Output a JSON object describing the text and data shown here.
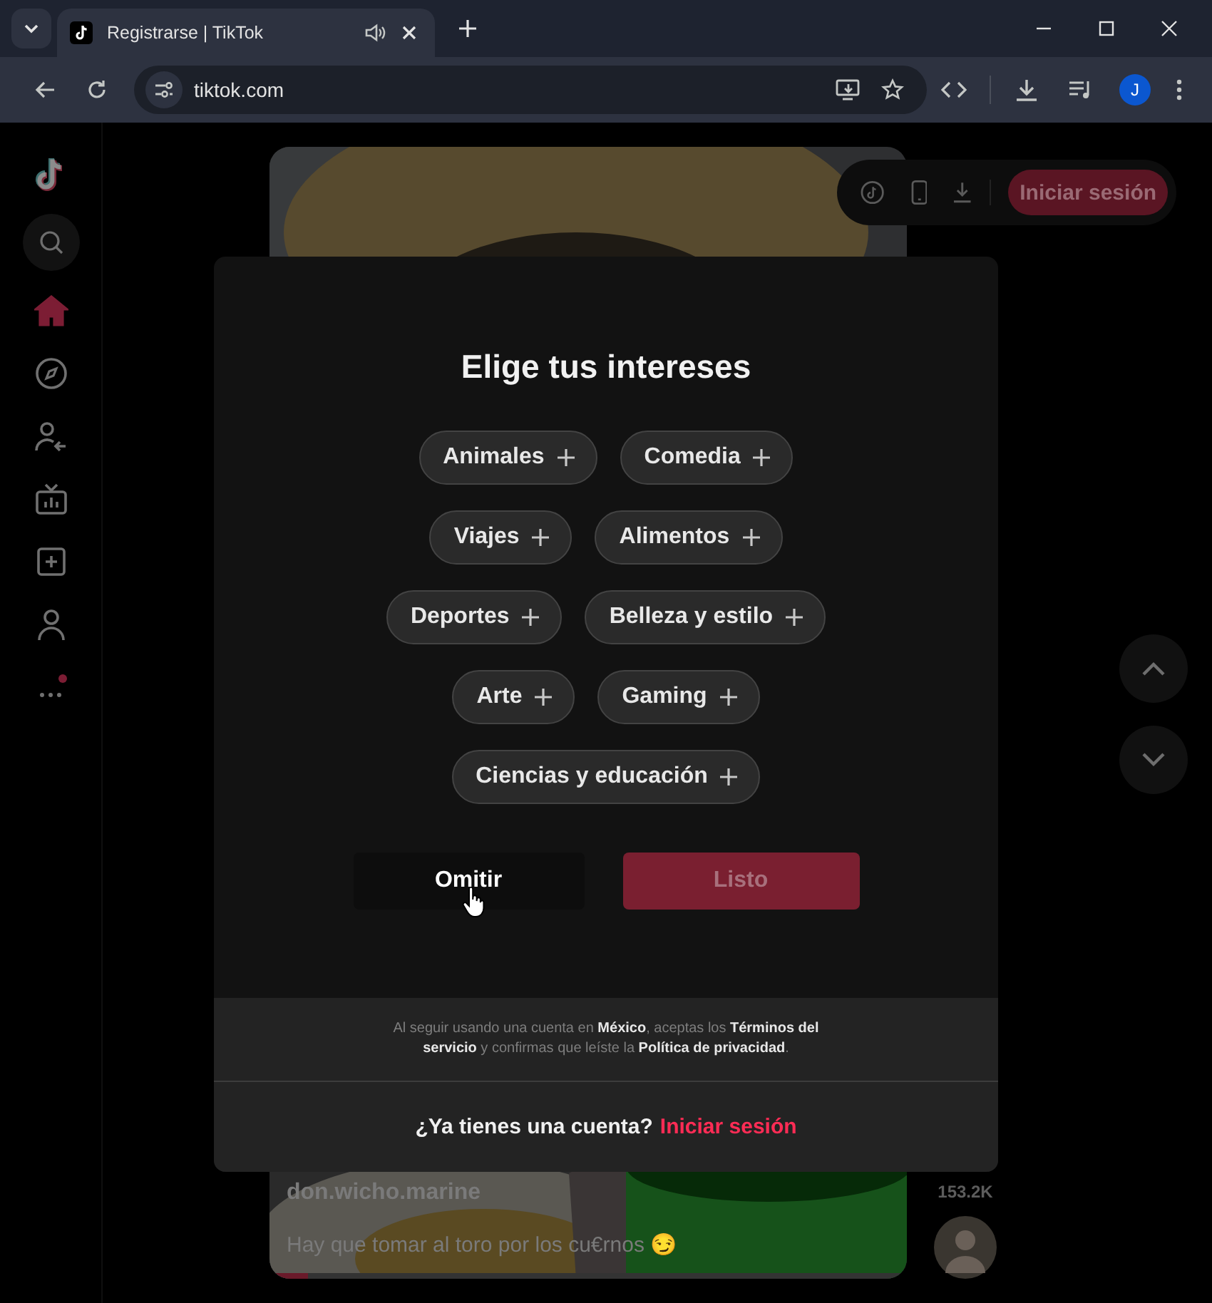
{
  "browser": {
    "tab": {
      "title": "Registrarse | TikTok",
      "audio": true
    },
    "url": "tiktok.com",
    "profile_initial": "J"
  },
  "sidebar": {
    "items": [
      {
        "kind": "home",
        "selected": true,
        "badge": false
      },
      {
        "kind": "explore",
        "selected": false,
        "badge": false
      },
      {
        "kind": "following",
        "selected": false,
        "badge": false
      },
      {
        "kind": "live",
        "selected": false,
        "badge": false
      },
      {
        "kind": "upload",
        "selected": false,
        "badge": false
      },
      {
        "kind": "profile",
        "selected": false,
        "badge": false
      },
      {
        "kind": "more",
        "selected": false,
        "badge": true
      }
    ]
  },
  "header": {
    "login_button": "Iniciar sesión"
  },
  "video": {
    "username": "don.wicho.marine",
    "caption": "Hay que tomar al toro por los cu€rnos 😏",
    "count": "153.2K",
    "progress": {
      "level": 0.06
    }
  },
  "modal": {
    "title": "Elige tus intereses",
    "interest_rows": [
      [
        {
          "label": "Animales",
          "selected": false
        },
        {
          "label": "Comedia",
          "selected": false
        }
      ],
      [
        {
          "label": "Viajes",
          "selected": false
        },
        {
          "label": "Alimentos",
          "selected": false
        }
      ],
      [
        {
          "label": "Deportes",
          "selected": false
        },
        {
          "label": "Belleza y estilo",
          "selected": false
        }
      ],
      [
        {
          "label": "Arte",
          "selected": false
        },
        {
          "label": "Gaming",
          "selected": false
        }
      ],
      [
        {
          "label": "Ciencias y educación",
          "selected": false
        }
      ]
    ],
    "skip_button": "Omitir",
    "done_button": {
      "label": "Listo",
      "disabled": true
    },
    "terms": "Al seguir usando una cuenta en **México**, aceptas los **Términos del servicio** y confirmas que leíste la **Política de privacidad**.",
    "login_prompt": "¿Ya tienes una cuenta?",
    "login_link": "Iniciar sesión"
  }
}
